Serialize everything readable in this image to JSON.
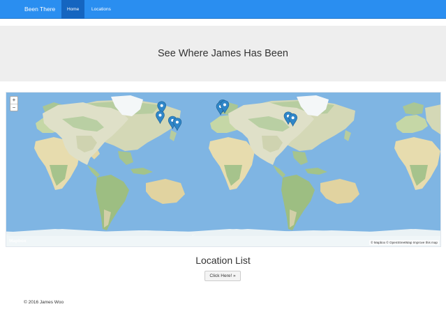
{
  "navbar": {
    "brand": "Been There",
    "items": [
      {
        "label": "Home",
        "active": true
      },
      {
        "label": "Locations",
        "active": false
      }
    ]
  },
  "header": {
    "title": "See Where James Has Been"
  },
  "map": {
    "zoom_in": "+",
    "zoom_out": "−",
    "logo": "Mapbox",
    "attribution": "© Mapbox © OpenStreetMap Improve this map",
    "marker_color": "#2f86c8",
    "markers": [
      {
        "lon": -118,
        "lat": 49
      },
      {
        "lon": -121,
        "lat": 38
      },
      {
        "lon": -97,
        "lat": 32
      },
      {
        "lon": -88,
        "lat": 30
      },
      {
        "lon": 0,
        "lat": 51
      },
      {
        "lon": -4,
        "lat": 48
      },
      {
        "lon": 4,
        "lat": 50
      },
      {
        "lon": 127,
        "lat": 37
      },
      {
        "lon": 136,
        "lat": 35
      }
    ]
  },
  "locations": {
    "title": "Location List",
    "button": "Click Here! »"
  },
  "footer": {
    "text": "© 2016 James Woo"
  }
}
